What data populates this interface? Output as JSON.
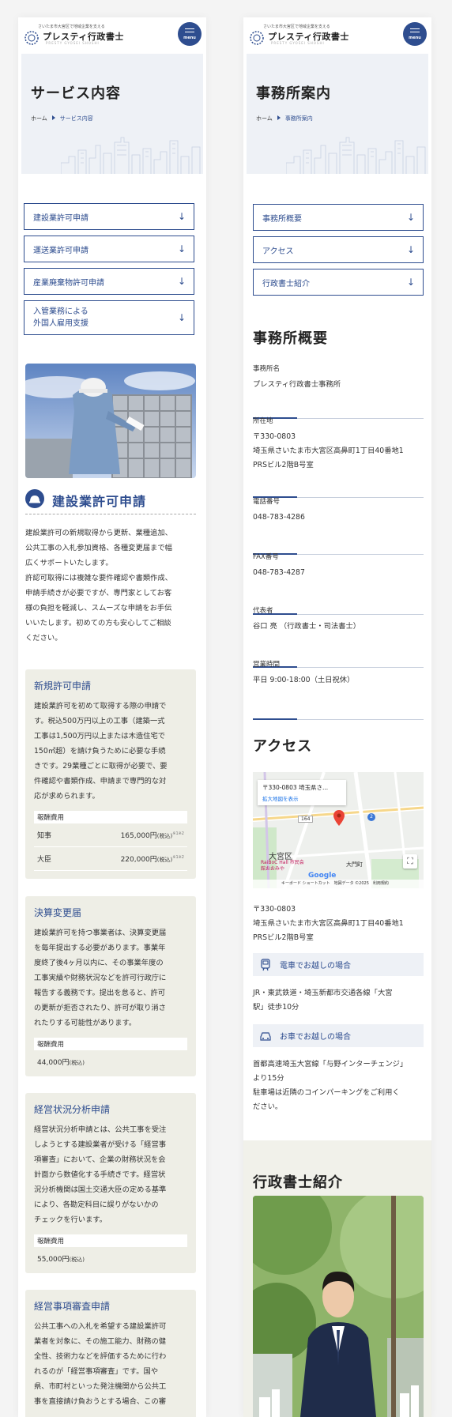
{
  "header": {
    "tagline": "さいたま市大宮区で地域企業を支える",
    "brand": "プレスティ行政書士",
    "brand_sub": "PRESTY GYOSEI SHOSHI",
    "menu_label": "menu"
  },
  "left": {
    "page_title": "サービス内容",
    "breadcrumb": {
      "home": "ホーム",
      "current": "サービス内容"
    },
    "anchors": [
      {
        "label": "建設業許可申請"
      },
      {
        "label": "運送業許可申請"
      },
      {
        "label": "産業廃棄物許可申請"
      },
      {
        "label_line1": "入管業務による",
        "label_line2": "外国人雇用支援"
      }
    ],
    "section_title": "建設業許可申請",
    "intro": [
      "建設業許可の新規取得から更新、業種追加、",
      "公共工事の入札参加資格、各種変更届まで幅",
      "広くサポートいたします。",
      "許認可取得には複雑な要件確認や書類作成、",
      "申請手続きが必要ですが、専門家としてお客",
      "様の負担を軽減し、スムーズな申請をお手伝",
      "いいたします。初めての方も安心してご相談",
      "ください。"
    ],
    "cards": [
      {
        "title": "新規許可申請",
        "lines": [
          "建設業許可を初めて取得する際の申請で",
          "す。税込500万円以上の工事（建築一式",
          "工事は1,500万円以上または木造住宅で",
          "150㎡超）を請け負うために必要な手続",
          "きです。29業種ごとに取得が必要で、要",
          "件確認や書類作成、申請まで専門的な対",
          "応が求められます。"
        ],
        "fee_label": "報酬費用",
        "fees": [
          {
            "name": "知事",
            "amount": "165,000円",
            "tax": "(税込)",
            "note": "※1※2"
          },
          {
            "name": "大臣",
            "amount": "220,000円",
            "tax": "(税込)",
            "note": "※1※2"
          }
        ]
      },
      {
        "title": "決算変更届",
        "lines": [
          "建設業許可を持つ事業者は、決算変更届",
          "を毎年提出する必要があります。事業年",
          "度終了後4ヶ月以内に、その事業年度の",
          "工事実績や財務状況などを許可行政庁に",
          "報告する義務です。提出を怠ると、許可",
          "の更新が拒否されたり、許可が取り消さ",
          "れたりする可能性があります。"
        ],
        "fee_label": "報酬費用",
        "fee_amount": "44,000円",
        "fee_tax": "(税込)"
      },
      {
        "title": "経営状況分析申請",
        "lines": [
          "経営状況分析申請とは、公共工事を受注",
          "しようとする建設業者が受ける「経営事",
          "項審査」において、企業の財務状況を会",
          "計面から数値化する手続きです。経営状",
          "況分析機関は国土交通大臣の定める基準",
          "により、各勘定科目に誤りがないかの",
          "チェックを行います。"
        ],
        "fee_label": "報酬費用",
        "fee_amount": "55,000円",
        "fee_tax": "(税込)"
      },
      {
        "title": "経営事項審査申請",
        "lines": [
          "公共工事への入札を希望する建設業許可",
          "業者を対象に、その施工能力、財務の健",
          "全性、技術力などを評価するために行わ",
          "れるのが「経営事項審査」です。国や",
          "県、市町村といった発注機関から公共工",
          "事を直接請け負おうとする場合、この審"
        ]
      }
    ]
  },
  "right": {
    "page_title": "事務所案内",
    "breadcrumb": {
      "home": "ホーム",
      "current": "事務所案内"
    },
    "anchors": [
      {
        "label": "事務所概要"
      },
      {
        "label": "アクセス"
      },
      {
        "label": "行政書士紹介"
      }
    ],
    "overview_title": "事務所概要",
    "overview": [
      {
        "label": "事務所名",
        "value": [
          "プレスティ行政書士事務所"
        ]
      },
      {
        "label": "所在地",
        "value": [
          "〒330-0803",
          "埼玉県さいたま市大宮区高鼻町1丁目40番地1",
          "PRSビル2階B号室"
        ]
      },
      {
        "label": "電話番号",
        "value": [
          "048-783-4286"
        ]
      },
      {
        "label": "FAX番号",
        "value": [
          "048-783-4287"
        ]
      },
      {
        "label": "代表者",
        "value": [
          "谷口 亮 （行政書士・司法書士）"
        ]
      },
      {
        "label": "営業時間",
        "value": [
          "平日 9:00-18:00（土日祝休）"
        ]
      }
    ],
    "access_title": "アクセス",
    "map": {
      "card_address": "〒330-0803 埼玉県さ...",
      "card_link": "拡大地図を表示",
      "district": "大宮区",
      "poi": "RaiBoC Hall 市民会館おおみや",
      "station": "大門町",
      "google": "Google",
      "footer": "キーボード ショートカット　地図データ ©2025　利用規約",
      "road_164": "164",
      "road_2": "2"
    },
    "access_address": [
      "〒330-0803",
      "埼玉県さいたま市大宮区高鼻町1丁目40番地1",
      "PRSビル2階B号室"
    ],
    "train_head": "電車でお越しの場合",
    "train_text": [
      "JR・東武鉄道・埼玉新都市交通各線「大宮",
      "駅」徒歩10分"
    ],
    "car_head": "お車でお越しの場合",
    "car_text": [
      "首都高速埼玉大宮線「与野インターチェンジ」",
      "より15分",
      "駐車場は近隣のコインパーキングをご利用く",
      "ださい。"
    ],
    "intro_title": "行政書士紹介"
  },
  "colors": {
    "navy": "#2e4d8f",
    "hero_bg": "#eef1f6",
    "card_bg": "#eeeee6"
  }
}
